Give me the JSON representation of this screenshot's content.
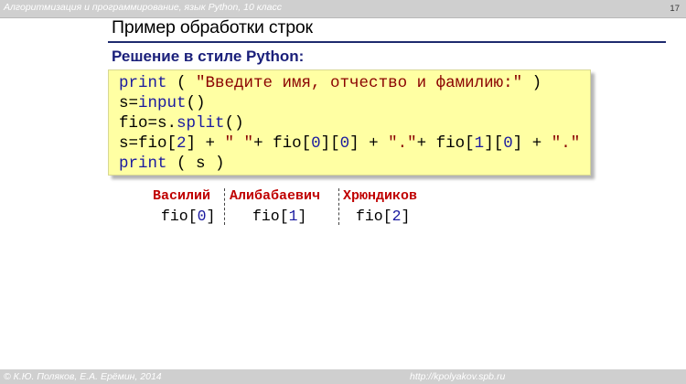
{
  "header": {
    "course": "Алгоритмизация и программирование, язык Python, 10 класс",
    "page_number": "17"
  },
  "slide": {
    "title": "Пример обработки строк",
    "subtitle": "Решение в стиле Python:"
  },
  "code": {
    "line1": {
      "kw": "print",
      "open": " ( ",
      "str": "\"Введите имя, отчество и фамилию:\"",
      "close": " )"
    },
    "line2": {
      "var": "s",
      "eq": "=",
      "fn": "input",
      "paren": "()"
    },
    "line3": {
      "var": "fio",
      "eq": "=",
      "obj": "s.",
      "fn": "split",
      "paren": "()"
    },
    "line4": {
      "p1": "s=fio[",
      "n1": "2",
      "p2": "] + ",
      "s1": "\" \"",
      "p3": "+ fio[",
      "n2": "0",
      "p4": "][",
      "n3": "0",
      "p5": "] + ",
      "s2": "\".\"",
      "p6": "+ fio[",
      "n4": "1",
      "p7": "][",
      "n5": "0",
      "p8": "] + ",
      "s3": "\".\""
    },
    "line5": {
      "kw": "print",
      "rest": " ( s )"
    }
  },
  "example": {
    "names": [
      "Василий",
      "Алибабаевич",
      "Хрюндиков"
    ],
    "indexes": [
      {
        "pre": "fio[",
        "num": "0",
        "post": "]"
      },
      {
        "pre": "fio[",
        "num": "1",
        "post": "]"
      },
      {
        "pre": "fio[",
        "num": "2",
        "post": "]"
      }
    ]
  },
  "footer": {
    "authors": "© К.Ю. Поляков, Е.А. Ерёмин, 2014",
    "url": "http://kpolyakov.spb.ru"
  },
  "colors": {
    "code_background": "#ffffa3",
    "subtitle": "#1a1f7a",
    "names": "#c00000",
    "rule": "#1e2a6e"
  }
}
